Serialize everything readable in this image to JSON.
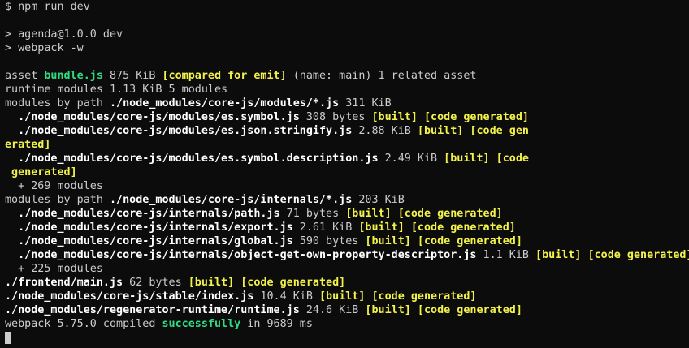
{
  "lines": [
    [
      {
        "t": "$ npm run dev",
        "c": ""
      }
    ],
    [],
    [
      {
        "t": "> agenda@1.0.0 dev",
        "c": ""
      }
    ],
    [
      {
        "t": "> webpack -w",
        "c": ""
      }
    ],
    [],
    [
      {
        "t": "asset ",
        "c": ""
      },
      {
        "t": "bundle.js",
        "c": "g"
      },
      {
        "t": " 875 KiB ",
        "c": ""
      },
      {
        "t": "[compared for emit]",
        "c": "y"
      },
      {
        "t": " (name: main) 1 related asset",
        "c": ""
      }
    ],
    [
      {
        "t": "runtime modules 1.13 KiB 5 modules",
        "c": ""
      }
    ],
    [
      {
        "t": "modules by path ",
        "c": ""
      },
      {
        "t": "./node_modules/core-js/modules/*.js",
        "c": "w"
      },
      {
        "t": " 311 KiB",
        "c": ""
      }
    ],
    [
      {
        "t": "  ./node_modules/core-js/modules/es.symbol.js",
        "c": "w"
      },
      {
        "t": " 308 bytes ",
        "c": ""
      },
      {
        "t": "[built]",
        "c": "y"
      },
      {
        "t": " ",
        "c": ""
      },
      {
        "t": "[code generated]",
        "c": "y"
      }
    ],
    [
      {
        "t": "  ./node_modules/core-js/modules/es.json.stringify.js",
        "c": "w"
      },
      {
        "t": " 2.88 KiB ",
        "c": ""
      },
      {
        "t": "[built]",
        "c": "y"
      },
      {
        "t": " ",
        "c": ""
      },
      {
        "t": "[code gen",
        "c": "y"
      }
    ],
    [
      {
        "t": "erated]",
        "c": "y"
      }
    ],
    [
      {
        "t": "  ./node_modules/core-js/modules/es.symbol.description.js",
        "c": "w"
      },
      {
        "t": " 2.49 KiB ",
        "c": ""
      },
      {
        "t": "[built]",
        "c": "y"
      },
      {
        "t": " ",
        "c": ""
      },
      {
        "t": "[code",
        "c": "y"
      }
    ],
    [
      {
        "t": " generated]",
        "c": "y"
      }
    ],
    [
      {
        "t": "  + 269 modules",
        "c": ""
      }
    ],
    [
      {
        "t": "modules by path ",
        "c": ""
      },
      {
        "t": "./node_modules/core-js/internals/*.js",
        "c": "w"
      },
      {
        "t": " 203 KiB",
        "c": ""
      }
    ],
    [
      {
        "t": "  ./node_modules/core-js/internals/path.js",
        "c": "w"
      },
      {
        "t": " 71 bytes ",
        "c": ""
      },
      {
        "t": "[built]",
        "c": "y"
      },
      {
        "t": " ",
        "c": ""
      },
      {
        "t": "[code generated]",
        "c": "y"
      }
    ],
    [
      {
        "t": "  ./node_modules/core-js/internals/export.js",
        "c": "w"
      },
      {
        "t": " 2.61 KiB ",
        "c": ""
      },
      {
        "t": "[built]",
        "c": "y"
      },
      {
        "t": " ",
        "c": ""
      },
      {
        "t": "[code generated]",
        "c": "y"
      }
    ],
    [
      {
        "t": "  ./node_modules/core-js/internals/global.js",
        "c": "w"
      },
      {
        "t": " 590 bytes ",
        "c": ""
      },
      {
        "t": "[built]",
        "c": "y"
      },
      {
        "t": " ",
        "c": ""
      },
      {
        "t": "[code generated]",
        "c": "y"
      }
    ],
    [
      {
        "t": "  ./node_modules/core-js/internals/object-get-own-property-descriptor.js",
        "c": "w"
      },
      {
        "t": " 1.1 KiB ",
        "c": ""
      },
      {
        "t": "[built]",
        "c": "y"
      },
      {
        "t": " ",
        "c": ""
      },
      {
        "t": "[code generated]",
        "c": "y"
      }
    ],
    [
      {
        "t": "  + 225 modules",
        "c": ""
      }
    ],
    [
      {
        "t": "./frontend/main.js",
        "c": "w"
      },
      {
        "t": " 62 bytes ",
        "c": ""
      },
      {
        "t": "[built]",
        "c": "y"
      },
      {
        "t": " ",
        "c": ""
      },
      {
        "t": "[code generated]",
        "c": "y"
      }
    ],
    [
      {
        "t": "./node_modules/core-js/stable/index.js",
        "c": "w"
      },
      {
        "t": " 10.4 KiB ",
        "c": ""
      },
      {
        "t": "[built]",
        "c": "y"
      },
      {
        "t": " ",
        "c": ""
      },
      {
        "t": "[code generated]",
        "c": "y"
      }
    ],
    [
      {
        "t": "./node_modules/regenerator-runtime/runtime.js",
        "c": "w"
      },
      {
        "t": " 24.6 KiB ",
        "c": ""
      },
      {
        "t": "[built]",
        "c": "y"
      },
      {
        "t": " ",
        "c": ""
      },
      {
        "t": "[code generated]",
        "c": "y"
      }
    ],
    [
      {
        "t": "webpack 5.75.0 compiled ",
        "c": ""
      },
      {
        "t": "successfully",
        "c": "g"
      },
      {
        "t": " in 9689 ms",
        "c": ""
      }
    ]
  ],
  "colors": {
    "background": "#0c0c0c",
    "text": "#cccccc",
    "bright": "#ffffff",
    "green": "#2fdc84",
    "yellow": "#f2f24b"
  }
}
